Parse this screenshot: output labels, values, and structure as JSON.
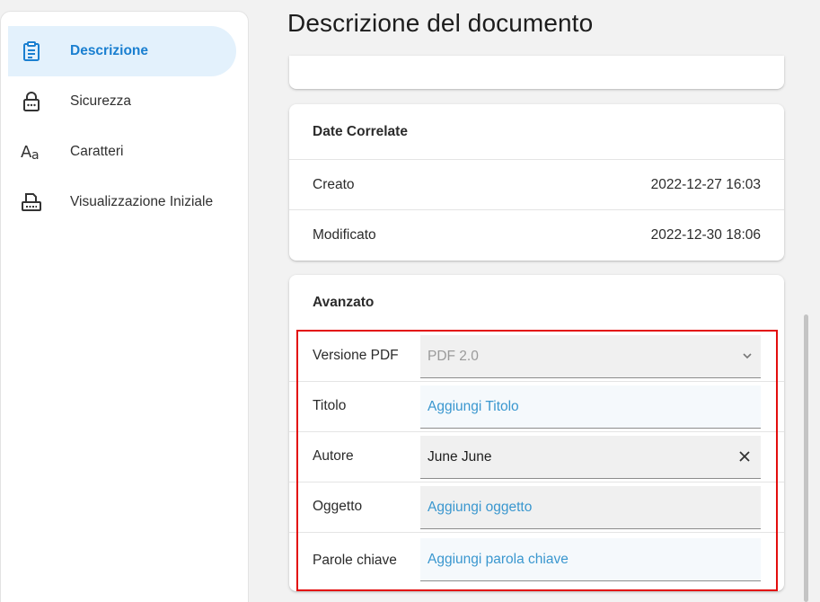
{
  "page": {
    "title": "Descrizione del documento"
  },
  "sidebar": {
    "items": [
      {
        "label": "Descrizione",
        "icon": "clipboard-list-icon",
        "active": true
      },
      {
        "label": "Sicurezza",
        "icon": "lock-icon",
        "active": false
      },
      {
        "label": "Caratteri",
        "icon": "font-icon",
        "active": false
      },
      {
        "label": "Visualizzazione Iniziale",
        "icon": "printer-view-icon",
        "active": false
      }
    ]
  },
  "dates": {
    "header": "Date Correlate",
    "rows": [
      {
        "label": "Creato",
        "value": "2022-12-27 16:03"
      },
      {
        "label": "Modificato",
        "value": "2022-12-30 18:06"
      }
    ]
  },
  "advanced": {
    "header": "Avanzato",
    "pdf_version": {
      "label": "Versione PDF",
      "value": "PDF 2.0"
    },
    "title": {
      "label": "Titolo",
      "placeholder": "Aggiungi Titolo"
    },
    "author": {
      "label": "Autore",
      "value": "June June"
    },
    "subject": {
      "label": "Oggetto",
      "placeholder": "Aggiungi oggetto"
    },
    "keywords": {
      "label": "Parole chiave",
      "placeholder": "Aggiungi parola chiave"
    }
  },
  "colors": {
    "accent": "#1a7fd0",
    "active_bg": "#e3f1fc",
    "placeholder": "#3a97cf",
    "highlight_border": "#e30d0d"
  }
}
